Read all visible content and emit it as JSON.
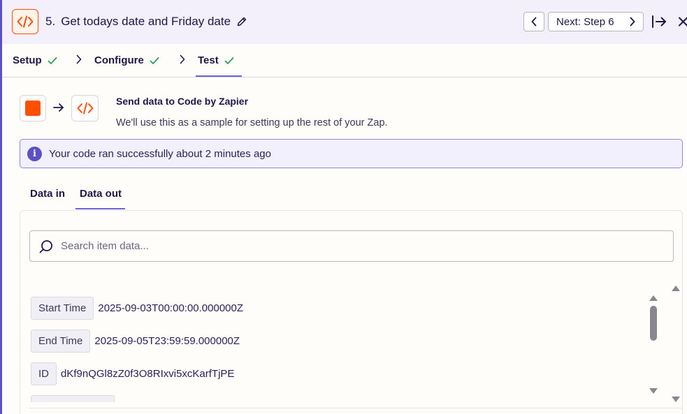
{
  "header": {
    "step_number": "5.",
    "title": "Get todays date and Friday date",
    "next_label": "Next: Step 6",
    "icons": [
      "code-icon",
      "pencil-icon",
      "chevron-left-icon",
      "chevron-right-icon",
      "expand-icon",
      "close-icon"
    ]
  },
  "steps": [
    {
      "label": "Setup",
      "done": true
    },
    {
      "label": "Configure",
      "done": true
    },
    {
      "label": "Test",
      "done": true
    }
  ],
  "send": {
    "title": "Send data to Code by Zapier",
    "subtitle": "We'll use this as a sample for setting up the rest of your Zap."
  },
  "info_banner": {
    "text": "Your code ran successfully about 2 minutes ago"
  },
  "tabs": [
    {
      "label": "Data in",
      "active": false
    },
    {
      "label": "Data out",
      "active": true
    }
  ],
  "search": {
    "placeholder": "Search item data..."
  },
  "data_out": [
    {
      "key": "Start Time",
      "value": "2025-09-03T00:00:00.000000Z"
    },
    {
      "key": "End Time",
      "value": "2025-09-05T23:59:59.000000Z"
    },
    {
      "key": "ID",
      "value": "dKf9nQGl8zZ0f3O8RIxvi5xcKarfTjPE"
    }
  ],
  "colors": {
    "accent": "#6f63d9",
    "brand_orange": "#ff4f00",
    "success_green": "#2e9e5b",
    "header_bg": "#f3f0fb"
  }
}
